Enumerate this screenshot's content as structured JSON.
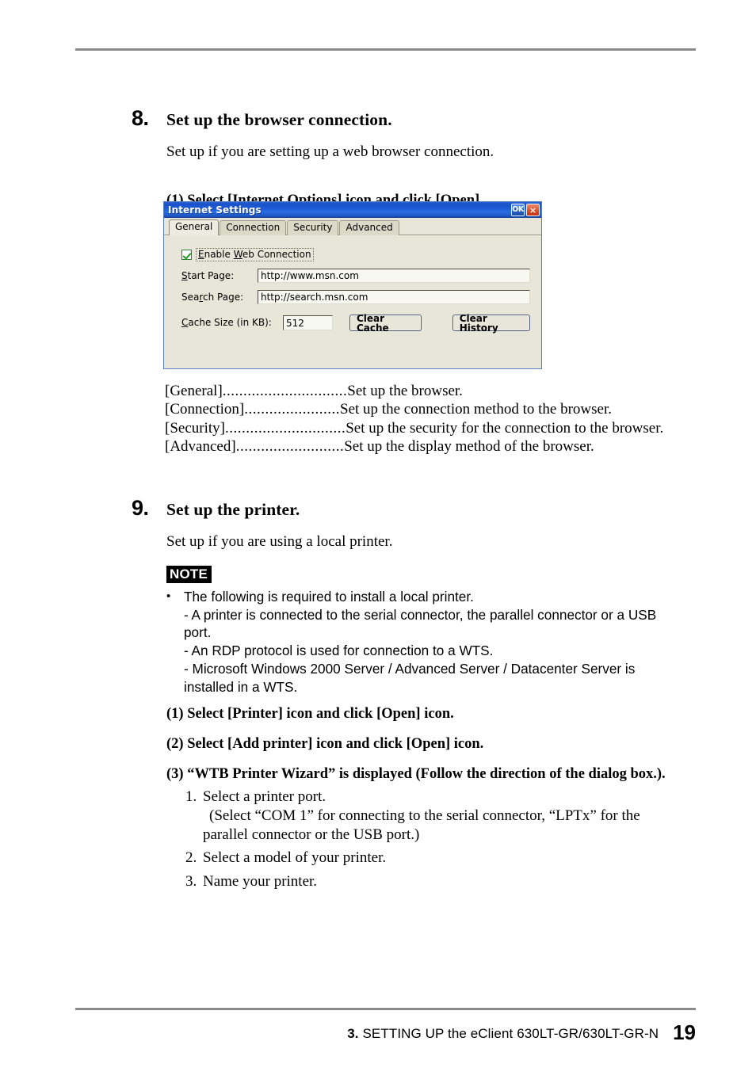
{
  "page": {
    "number": "19",
    "footer_prefix": "3.",
    "footer_text": "SETTING UP the eClient 630LT-GR/630LT-GR-N"
  },
  "section8": {
    "number": "8.",
    "title": "Set up the browser connection.",
    "subtitle": "Set up if you are setting up a web browser connection.",
    "step1": "(1)  Select [Internet Options] icon and click [Open]."
  },
  "dialog": {
    "title": "Internet Settings",
    "ok_label": "OK",
    "close_label": "×",
    "tabs": [
      {
        "label": "General",
        "active": true
      },
      {
        "label": "Connection",
        "active": false
      },
      {
        "label": "Security",
        "active": false
      },
      {
        "label": "Advanced",
        "active": false
      }
    ],
    "checkbox": {
      "label_pre": "E",
      "label_mid": "nable ",
      "label_acc2": "W",
      "label_post": "eb Connection",
      "checked": true
    },
    "start_page": {
      "label_acc": "S",
      "label_rest": "tart Page:",
      "value": "http://www.msn.com"
    },
    "search_page": {
      "label_pre": "Sea",
      "label_acc": "r",
      "label_post": "ch Page:",
      "value": "http://search.msn.com"
    },
    "cache": {
      "label_acc": "C",
      "label_rest": "ache Size (in KB):",
      "value": "512",
      "clear_cache_label": "Clear Cache",
      "clear_history_label": "Clear History"
    },
    "colors": {
      "titlebar_blue": "#1d5ad6",
      "body_beige": "#e8e6d9",
      "ok_blue": "#2b62c8",
      "close_red": "#e05b35",
      "check_green": "#1e9e1e"
    }
  },
  "leaders": [
    {
      "key": "[General]",
      "dots": "..............................",
      "value": "Set up the browser."
    },
    {
      "key": "[Connection]",
      "dots": ".......................",
      "value": "Set up the connection method to the browser."
    },
    {
      "key": "[Security]",
      "dots": ".............................",
      "value": "Set up the security for the connection to the browser."
    },
    {
      "key": "[Advanced]",
      "dots": "..........................",
      "value": "Set up the display method of the browser."
    }
  ],
  "section9": {
    "number": "9.",
    "title": "Set up the printer.",
    "subtitle": "Set up if you are using a local printer.",
    "note": {
      "tag": "NOTE",
      "bullet": "•",
      "lines": [
        "The following is required to install a local printer.",
        "- A printer is connected to the serial connector, the parallel connector or a USB",
        "port.",
        "- An RDP protocol is used for connection to a WTS.",
        "- Microsoft Windows 2000 Server / Advanced Server / Datacenter Server is",
        "installed in a WTS."
      ]
    },
    "steps": [
      "(1)  Select [Printer] icon and click [Open] icon.",
      "(2)  Select [Add printer] icon and click [Open] icon.",
      "(3)  “WTB Printer Wizard” is displayed (Follow the direction of the dialog box.)."
    ],
    "substeps": [
      {
        "num": "1.",
        "lines": [
          "Select a printer port.",
          "(Select “COM 1” for connecting to the serial connector, “LPTx” for the",
          "parallel connector or the USB port.)"
        ]
      },
      {
        "num": "2.",
        "lines": [
          "Select a model of your printer."
        ]
      },
      {
        "num": "3.",
        "lines": [
          "Name your printer."
        ]
      }
    ]
  }
}
